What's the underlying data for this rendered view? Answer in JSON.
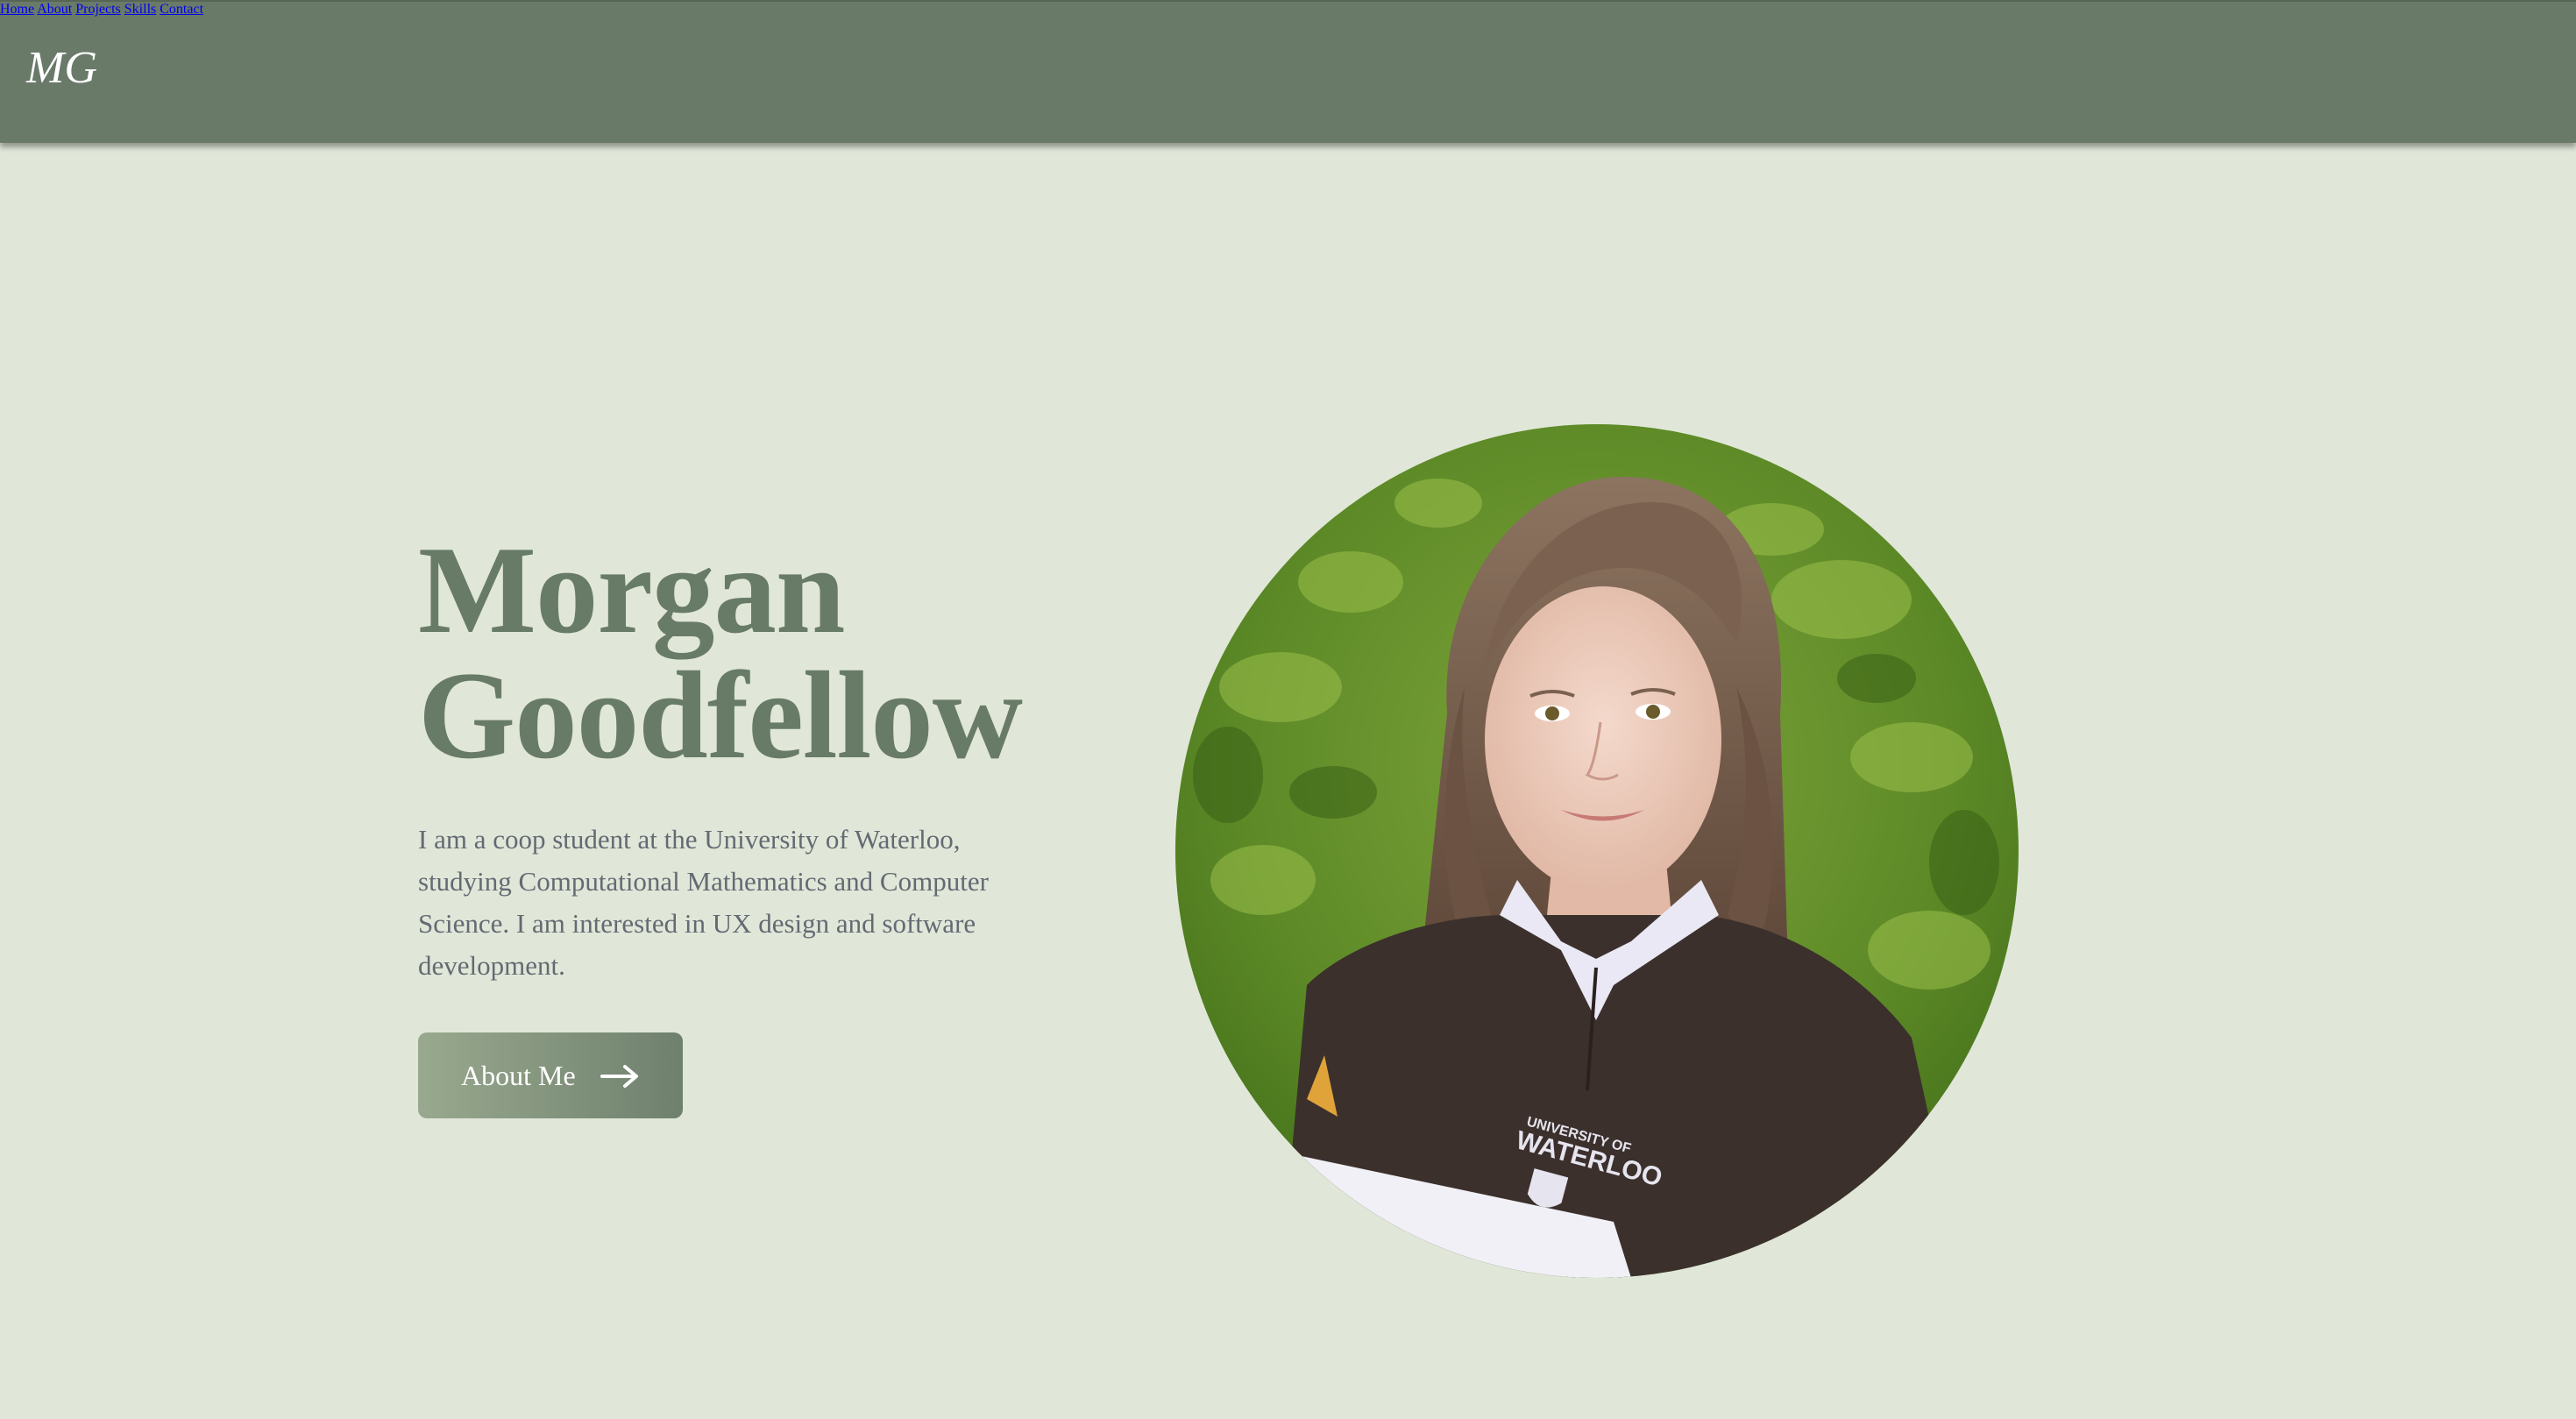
{
  "nav": {
    "logo": "MG",
    "items": [
      {
        "label": "Home"
      },
      {
        "label": "About"
      },
      {
        "label": "Projects"
      },
      {
        "label": "Skills"
      },
      {
        "label": "Contact"
      }
    ]
  },
  "hero": {
    "name_line1": "Morgan",
    "name_line2": "Goodfellow",
    "description": "I am a coop student at the University of Waterloo, studying Computational Mathematics and Computer Science. I am interested in UX design and software development.",
    "button_label": "About Me",
    "button_icon": "arrow-right-icon",
    "photo_icon": "portrait-photo",
    "sweater_text_line1": "UNIVERSITY OF",
    "sweater_text_line2": "WATERLOO"
  },
  "colors": {
    "navbar": "#697a69",
    "background": "#e0e7d8",
    "heading": "#687b66",
    "body_text": "#636a73"
  }
}
